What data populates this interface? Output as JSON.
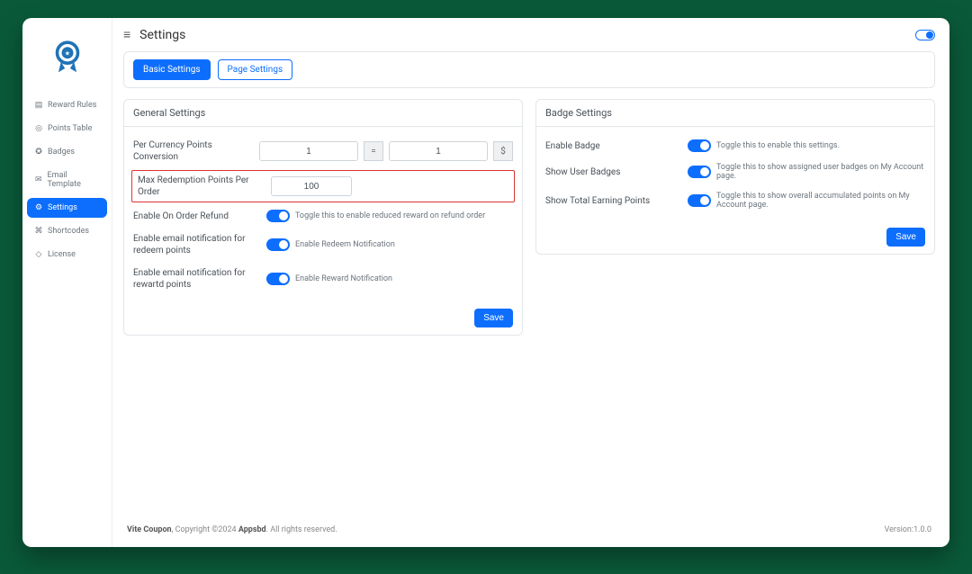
{
  "header": {
    "title": "Settings"
  },
  "sidebar": {
    "items": [
      {
        "icon": "▤",
        "label": "Reward Rules"
      },
      {
        "icon": "◎",
        "label": "Points Table"
      },
      {
        "icon": "✪",
        "label": "Badges"
      },
      {
        "icon": "✉",
        "label": "Email Template"
      },
      {
        "icon": "⚙",
        "label": "Settings"
      },
      {
        "icon": "⌘",
        "label": "Shortcodes"
      },
      {
        "icon": "◇",
        "label": "License"
      }
    ]
  },
  "tabs": {
    "basic": "Basic Settings",
    "page": "Page Settings"
  },
  "general": {
    "heading": "General Settings",
    "per_currency_label": "Per Currency Points Conversion",
    "per_currency_points": "1",
    "equals": "=",
    "per_currency_amount": "1",
    "currency_symbol": "$",
    "max_redemption_label": "Max Redemption Points Per Order",
    "max_redemption_value": "100",
    "enable_refund_label": "Enable On Order Refund",
    "enable_refund_desc": "Toggle this to enable reduced reward on refund order",
    "enable_redeem_notif_label": "Enable email notification for redeem points",
    "enable_redeem_notif_desc": "Enable Redeem Notification",
    "enable_reward_notif_label": "Enable email notification for rewartd points",
    "enable_reward_notif_desc": "Enable Reward Notification",
    "save": "Save"
  },
  "badge": {
    "heading": "Badge Settings",
    "enable_label": "Enable Badge",
    "enable_desc": "Toggle this to enable this settings.",
    "show_user_label": "Show User Badges",
    "show_user_desc": "Toggle this to show assigned user badges on My Account page.",
    "show_total_label": "Show Total Earning Points",
    "show_total_desc": "Toggle this to show overall accumulated points on My Account page.",
    "save": "Save"
  },
  "footer": {
    "product": "Vite Coupon",
    "copyright": ", Copyright ©2024 ",
    "company": "Appsbd",
    "rights": ". All rights reserved.",
    "version": "Version:1.0.0"
  }
}
